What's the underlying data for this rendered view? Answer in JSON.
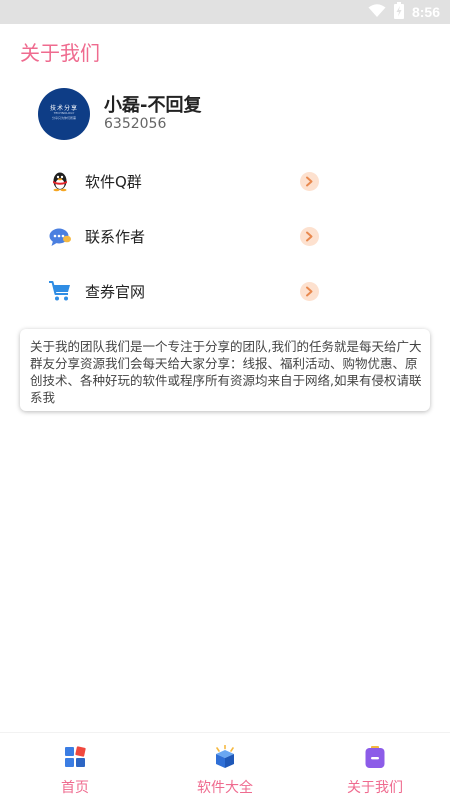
{
  "status_bar": {
    "time": "8:56"
  },
  "page": {
    "title": "关于我们"
  },
  "profile": {
    "avatar_text_line1": "技术分享",
    "avatar_text_line2": "TECHNOLOGY",
    "avatar_text_line3": "分享只为你们所需",
    "name": "小磊-不回复",
    "id": "6352056"
  },
  "menu": [
    {
      "label": "软件Q群",
      "icon": "qq-penguin-icon"
    },
    {
      "label": "联系作者",
      "icon": "chat-bubble-icon"
    },
    {
      "label": "查券官网",
      "icon": "shopping-cart-icon"
    }
  ],
  "about": {
    "text": "关于我的团队我们是一个专注于分享的团队,我们的任务就是每天给广大群友分享资源我们会每天给大家分享：线报、福利活动、购物优惠、原创技术、各种好玩的软件或程序所有资源均来自于网络,如果有侵权请联系我"
  },
  "bottom_nav": [
    {
      "label": "首页",
      "icon": "home-grid-icon"
    },
    {
      "label": "软件大全",
      "icon": "software-box-icon"
    },
    {
      "label": "关于我们",
      "icon": "about-card-icon"
    }
  ],
  "colors": {
    "accent": "#ef6b8f",
    "arrow_bg": "#fde1cf",
    "arrow_fg": "#e8894f"
  }
}
